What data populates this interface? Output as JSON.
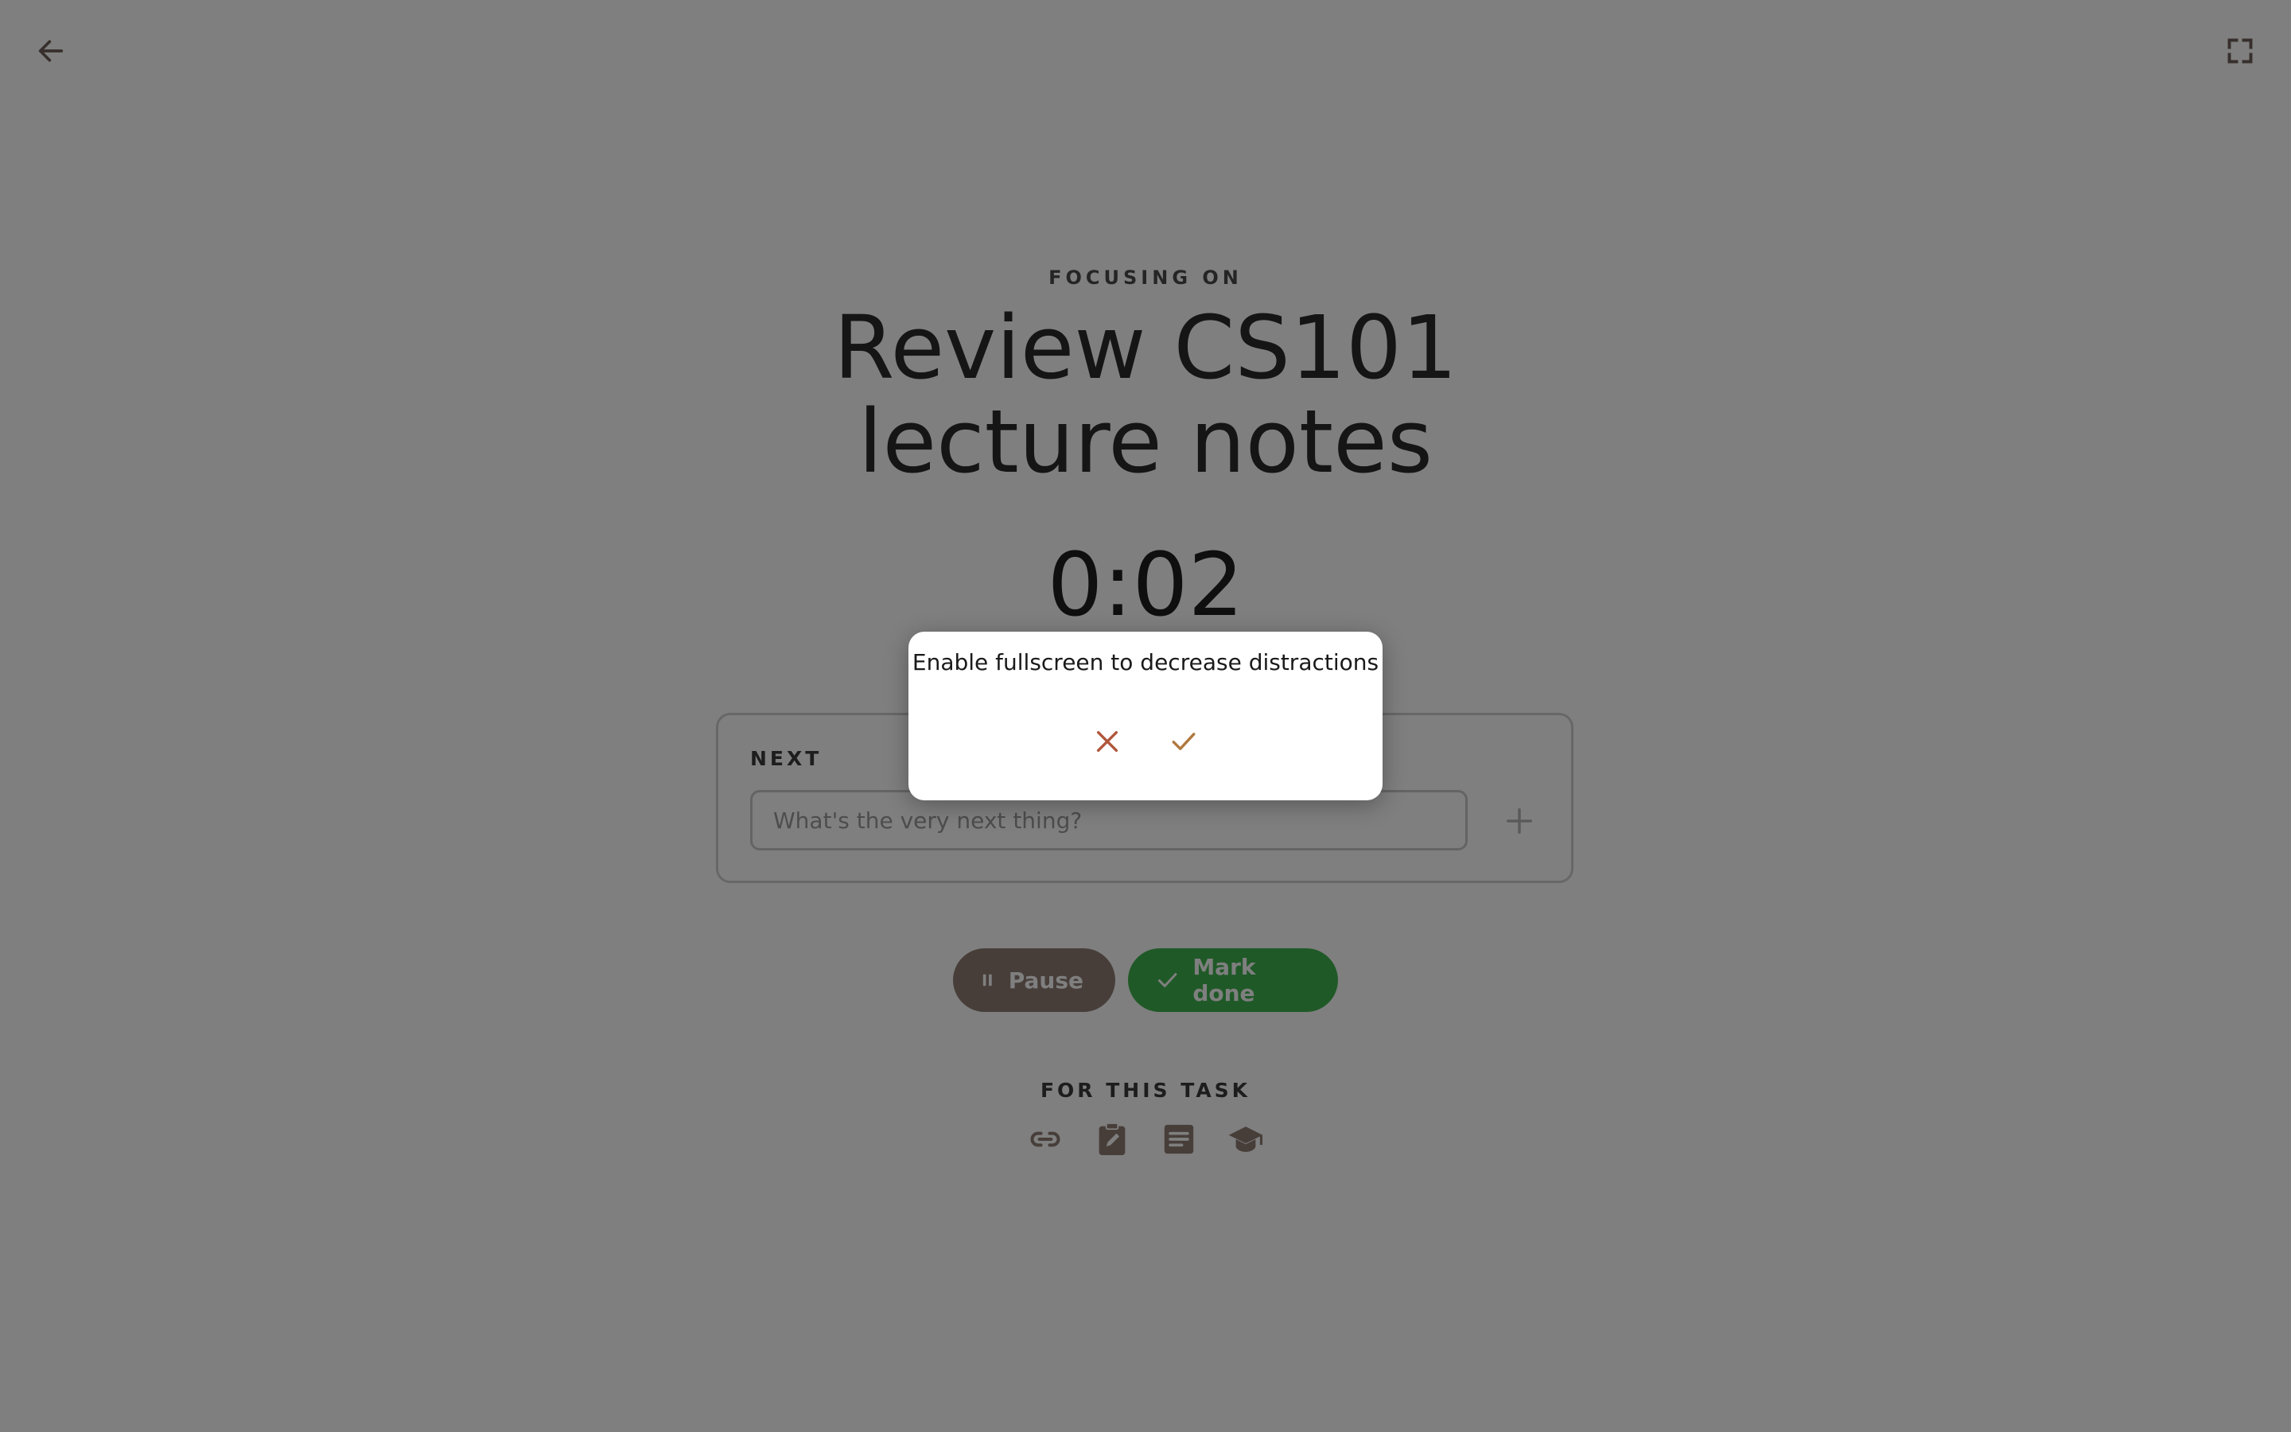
{
  "header": {
    "back_icon": "arrow-left-icon",
    "fullscreen_icon": "fullscreen-icon"
  },
  "focus": {
    "label": "FOCUSING ON",
    "task_title": "Review CS101 lecture notes",
    "timer": "0:02"
  },
  "next": {
    "label": "NEXT",
    "placeholder": "What's the very next thing?",
    "value": "",
    "add_icon": "plus-icon"
  },
  "actions": {
    "pause_label": "Pause",
    "pause_icon": "pause-icon",
    "done_label": "Mark done",
    "done_icon": "check-icon"
  },
  "resources": {
    "label": "FOR THIS TASK",
    "icons": [
      "link-icon",
      "clipboard-edit-icon",
      "document-icon",
      "graduation-cap-icon"
    ]
  },
  "dialog": {
    "message": "Enable fullscreen to decrease distractions",
    "cancel_icon": "close-icon",
    "confirm_icon": "check-icon"
  },
  "colors": {
    "overlay": "rgba(0,0,0,0.5)",
    "pause_button": "#8e7c74",
    "done_button": "#3fb34f",
    "icon_brown": "#8e7c74",
    "dialog_accent": "#b0563a"
  }
}
